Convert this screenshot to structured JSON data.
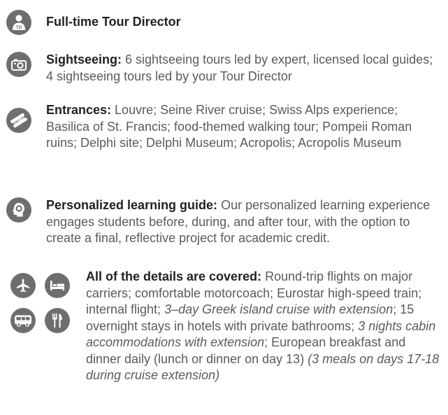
{
  "items": [
    {
      "icon": "tour-director-icon",
      "icon_text": "TD",
      "label": "Full-time Tour Director",
      "text": ""
    },
    {
      "icon": "camera-icon",
      "label": "Sightseeing:",
      "text": " 6 sightseeing tours led by expert, licensed local guides; 4 sightseeing tours led by your Tour Director"
    },
    {
      "icon": "admission-ticket-icon",
      "icon_text": "ADMIT ONE",
      "label": "Entrances:",
      "text": " Louvre; Seine River cruise; Swiss Alps experience; Basilica of St. Francis; food-themed walking tour; Pompeii Roman ruins; Delphi site; Delphi Museum; Acropolis; Acropolis Museum"
    },
    {
      "icon": "learning-head-icon",
      "label": "Personalized learning guide:",
      "text": " Our personalized learning experience engages students before, during, and after tour, with the option to create a final, reflective project for academic credit."
    }
  ],
  "details": {
    "icons": [
      "airplane-icon",
      "bed-icon",
      "bus-icon",
      "utensils-icon"
    ],
    "label": "All of the details are covered:",
    "parts": [
      {
        "text": " Round-trip flights on major carriers; comfortable motorcoach; Eurostar high-speed train; internal flight; ",
        "italic": false
      },
      {
        "text": "3–day Greek island cruise with extension",
        "italic": true
      },
      {
        "text": "; 15 overnight stays in hotels with private bathrooms; ",
        "italic": false
      },
      {
        "text": "3 nights cabin accommodations with extension",
        "italic": true
      },
      {
        "text": "; European breakfast and dinner daily (lunch or dinner on day 13) ",
        "italic": false
      },
      {
        "text": "(3 meals on days 17-18 during cruise extension)",
        "italic": true
      }
    ]
  },
  "colors": {
    "icon_background": "#6e6e6e",
    "label": "#222222",
    "body_text": "#5b5b5b"
  }
}
